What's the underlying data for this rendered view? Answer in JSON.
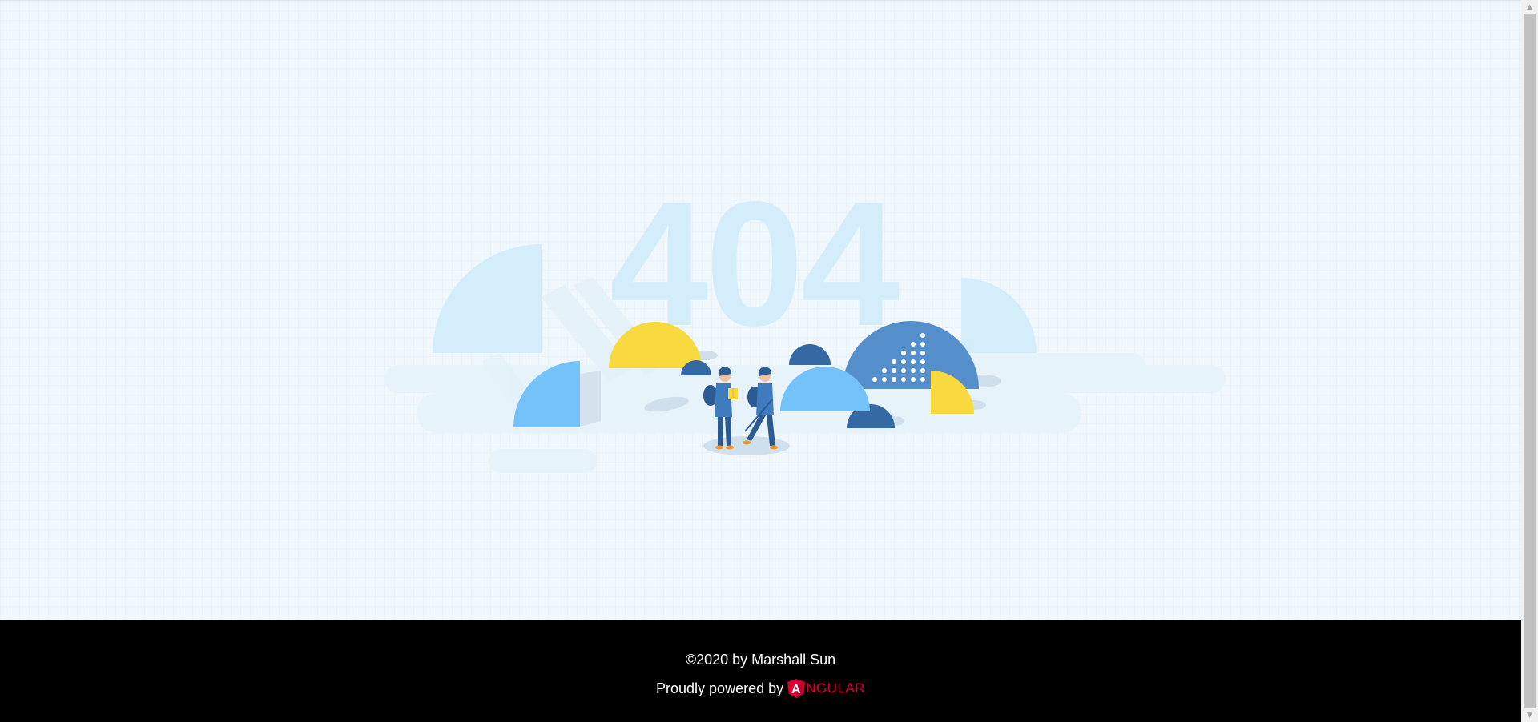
{
  "page": {
    "error_code": "404",
    "background_color": "#f1f8fd"
  },
  "footer": {
    "copyright": "©2020 by Marshall Sun",
    "powered_by": "Proudly powered by",
    "brand_letter": "A",
    "brand_rest": "NGULAR",
    "brand_color": "#dd0031",
    "background_color": "#000000"
  },
  "illustration": {
    "name": "404-illustration",
    "figures": [
      "hiker-reading-book",
      "hiker-with-walking-stick"
    ]
  },
  "scrollbar": {
    "up_icon": "scroll-up-arrow-icon",
    "down_icon": "scroll-down-arrow-icon"
  }
}
